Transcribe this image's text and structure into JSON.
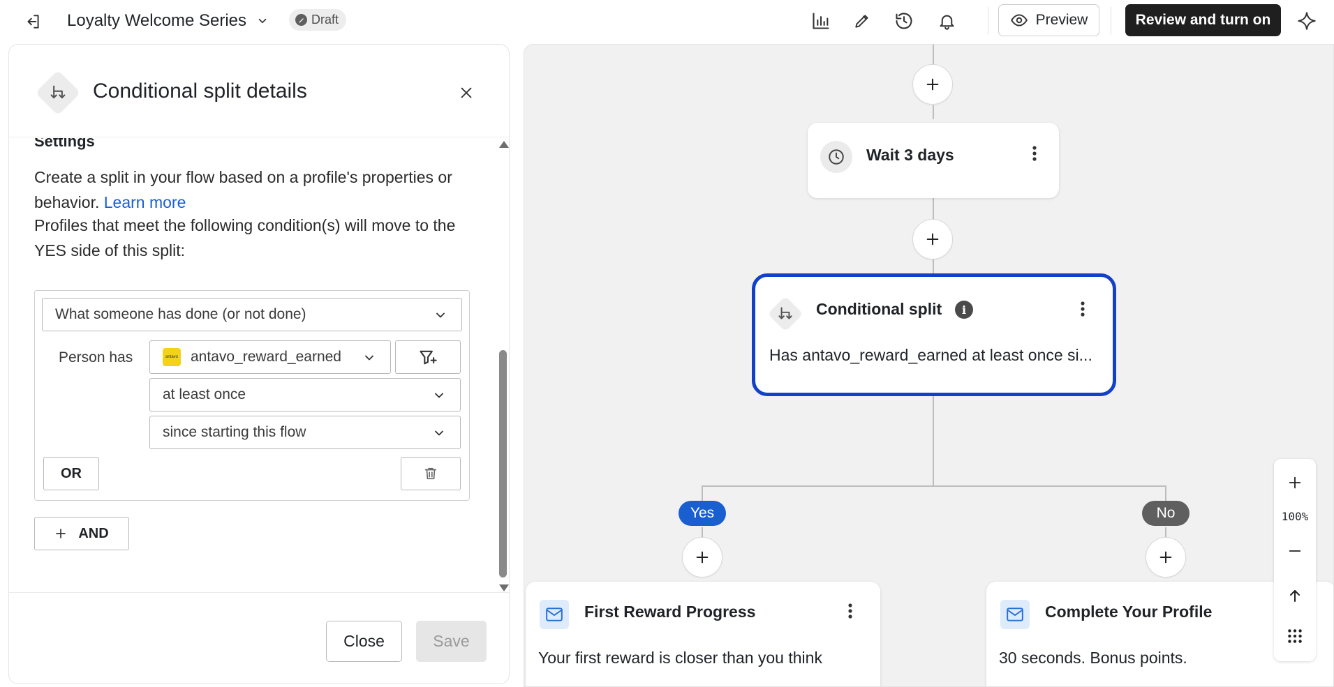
{
  "topbar": {
    "flow_title": "Loyalty Welcome Series",
    "status_badge": "Draft",
    "preview_label": "Preview",
    "review_label": "Review and turn on"
  },
  "panel": {
    "title": "Conditional split details",
    "settings_heading": "Settings",
    "description": "Create a split in your flow based on a profile's properties or behavior.",
    "learn_more": "Learn more",
    "condition_intro": "Profiles that meet the following condition(s) will move to the YES side of this split:",
    "condition_type": "What someone has done (or not done)",
    "person_has_label": "Person has",
    "metric": "antavo_reward_earned",
    "metric_logo_text": "antavo",
    "frequency": "at least once",
    "timeframe": "since starting this flow",
    "or_label": "OR",
    "and_label": "AND",
    "close_label": "Close",
    "save_label": "Save"
  },
  "canvas": {
    "wait_card": {
      "title": "Wait 3 days"
    },
    "split_card": {
      "title": "Conditional split",
      "summary": "Has antavo_reward_earned at least once si..."
    },
    "branch_yes": "Yes",
    "branch_no": "No",
    "yes_email": {
      "title": "First Reward Progress",
      "subtitle": "Your first reward is closer than you think"
    },
    "no_email": {
      "title": "Complete Your Profile",
      "subtitle": "30 seconds. Bonus points."
    },
    "zoom_level": "100%"
  },
  "colors": {
    "selected_border": "#1340c8",
    "yes_pill": "#1a5fd0",
    "no_pill": "#5f5f5f",
    "link": "#1a5fd0",
    "primary_button": "#1f1f1f",
    "metric_logo": "#f3d21c"
  },
  "icons": {
    "exit": "exit-icon",
    "analytics": "bar-chart-icon",
    "edit": "pencil-icon",
    "history": "history-icon",
    "notifications": "bell-icon",
    "preview": "eye-icon",
    "ai": "sparkle-icon",
    "close": "close-icon",
    "split": "split-icon",
    "filter": "filter-add-icon",
    "delete": "trash-icon",
    "wait": "clock-icon",
    "email": "mail-icon"
  }
}
